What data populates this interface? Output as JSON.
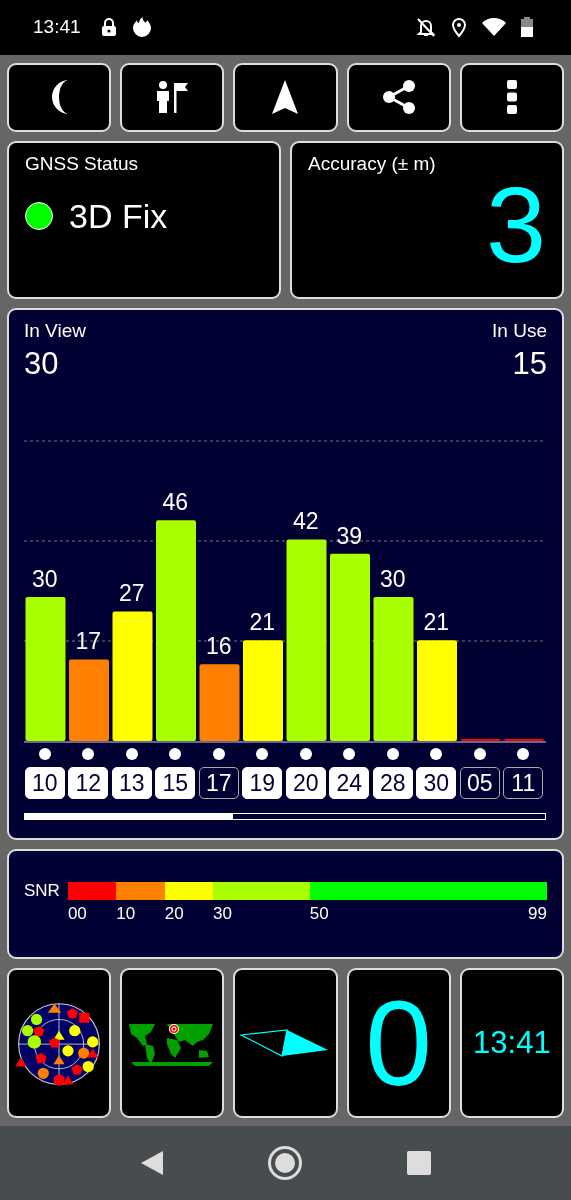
{
  "status_bar": {
    "time": "13:41"
  },
  "gnss_status": {
    "title": "GNSS Status",
    "fix": "3D Fix",
    "color": "#00ff00"
  },
  "accuracy": {
    "title": "Accuracy (± m)",
    "value": "3"
  },
  "in_view": {
    "label": "In View",
    "value": "30"
  },
  "in_use": {
    "label": "In Use",
    "value": "15"
  },
  "chart_data": {
    "type": "bar",
    "categories": [
      "10",
      "12",
      "13",
      "15",
      "17",
      "19",
      "20",
      "24",
      "28",
      "30",
      "05",
      "11"
    ],
    "values": [
      30,
      17,
      27,
      46,
      16,
      21,
      42,
      39,
      30,
      21,
      0,
      0
    ],
    "value_labels": [
      "30",
      "17",
      "27",
      "46",
      "16",
      "21",
      "42",
      "39",
      "30",
      "21",
      null,
      null
    ]
  },
  "satellites": [
    {
      "in_use": true
    },
    {
      "in_use": true
    },
    {
      "in_use": true
    },
    {
      "in_use": true
    },
    {
      "in_use": false
    },
    {
      "in_use": true
    },
    {
      "in_use": true
    },
    {
      "in_use": true
    },
    {
      "in_use": true
    },
    {
      "in_use": true
    },
    {
      "in_use": false
    },
    {
      "in_use": false
    }
  ],
  "snr_legend": {
    "label": "SNR",
    "end": "99",
    "segments": [
      {
        "from": "00",
        "color": "#ff0000"
      },
      {
        "from": "10",
        "color": "#ff8000"
      },
      {
        "from": "20",
        "color": "#ffff00"
      },
      {
        "from": "30",
        "color": "#a8ff00"
      },
      {
        "from": "50",
        "color": "#00ff00"
      }
    ]
  },
  "speed": {
    "value": "0"
  },
  "clock": {
    "time": "13:41"
  }
}
